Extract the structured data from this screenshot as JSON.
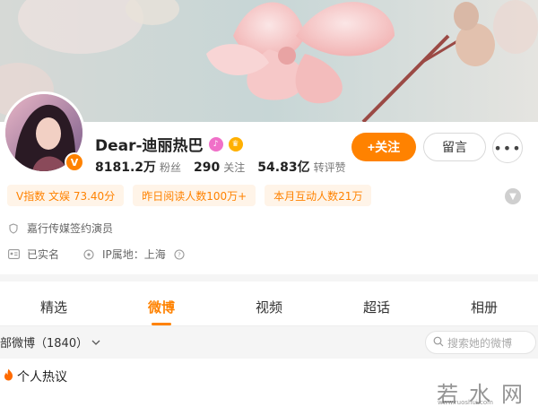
{
  "profile": {
    "name": "Dear-迪丽热巴",
    "verified_mark": "V",
    "stats": [
      {
        "value": "8181.2万",
        "label": "粉丝"
      },
      {
        "value": "290",
        "label": "关注"
      },
      {
        "value": "54.83亿",
        "label": "转评赞"
      }
    ],
    "follow_label": "+关注",
    "message_label": "留言",
    "more_label": "•••"
  },
  "tags": [
    "V指数 文娱 73.40分",
    "昨日阅读人数100万+",
    "本月互动人数21万"
  ],
  "info": {
    "agency": "嘉行传媒签约演员",
    "realname": "已实名",
    "ip": "IP属地：上海"
  },
  "tabs": [
    "精选",
    "微博",
    "视频",
    "超话",
    "相册"
  ],
  "active_tab": "微博",
  "feed": {
    "title": "部微博（1840）",
    "search_placeholder": "搜索她的微博"
  },
  "section": {
    "hot_title": "个人热议"
  },
  "watermark": {
    "text": "若水网",
    "url": "www.ruoshui.com"
  },
  "colors": {
    "accent": "#ff8200",
    "tag_bg": "#fff4e8"
  }
}
